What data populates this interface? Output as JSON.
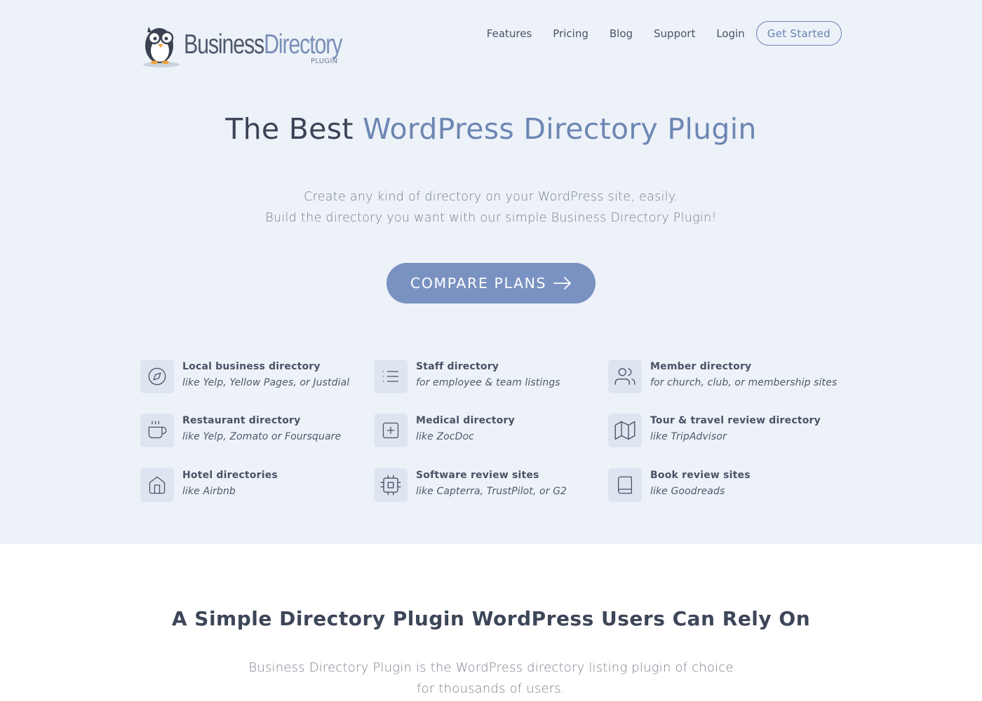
{
  "header": {
    "logo": {
      "word_part1": "Business",
      "word_part2": "Directory",
      "sub": "PLUGIN",
      "icon": "penguin-mascot-icon"
    },
    "nav": [
      "Features",
      "Pricing",
      "Blog",
      "Support",
      "Login"
    ],
    "cta": "Get Started"
  },
  "hero": {
    "title_plain": "The Best",
    "title_accent": "WordPress Directory Plugin",
    "subtitle_line1": "Create any kind of directory on your WordPress site, easily.",
    "subtitle_line2": "Build the directory you want with our simple Business Directory Plugin!",
    "button_label": "COMPARE PLANS",
    "button_icon": "arrow-right-icon"
  },
  "features": [
    {
      "title": "Local business directory",
      "desc": "like Yelp, Yellow Pages, or Justdial",
      "icon": "compass-icon"
    },
    {
      "title": "Staff directory",
      "desc": "for employee & team listings",
      "icon": "list-icon"
    },
    {
      "title": "Member directory",
      "desc": "for church, club, or membership sites",
      "icon": "users-icon"
    },
    {
      "title": "Restaurant directory",
      "desc": "like Yelp, Zomato or Foursquare",
      "icon": "coffee-cup-icon"
    },
    {
      "title": "Medical directory",
      "desc": "like ZocDoc",
      "icon": "plus-square-icon"
    },
    {
      "title": "Tour & travel review directory",
      "desc": "like TripAdvisor",
      "icon": "map-icon"
    },
    {
      "title": "Hotel directories",
      "desc": "like Airbnb",
      "icon": "home-icon"
    },
    {
      "title": "Software review sites",
      "desc": "like Capterra, TrustPilot, or G2",
      "icon": "cpu-icon"
    },
    {
      "title": "Book review sites",
      "desc": "like Goodreads",
      "icon": "book-icon"
    }
  ],
  "section2": {
    "title": "A Simple Directory Plugin WordPress Users Can Rely On",
    "text": "Business Directory Plugin is the WordPress directory listing plugin of choice for thousands of users."
  },
  "colors": {
    "hero_background": "#edf2f9",
    "accent": "#6d86b3",
    "button": "#7a92c2",
    "icon_tile": "#dde5f1"
  }
}
